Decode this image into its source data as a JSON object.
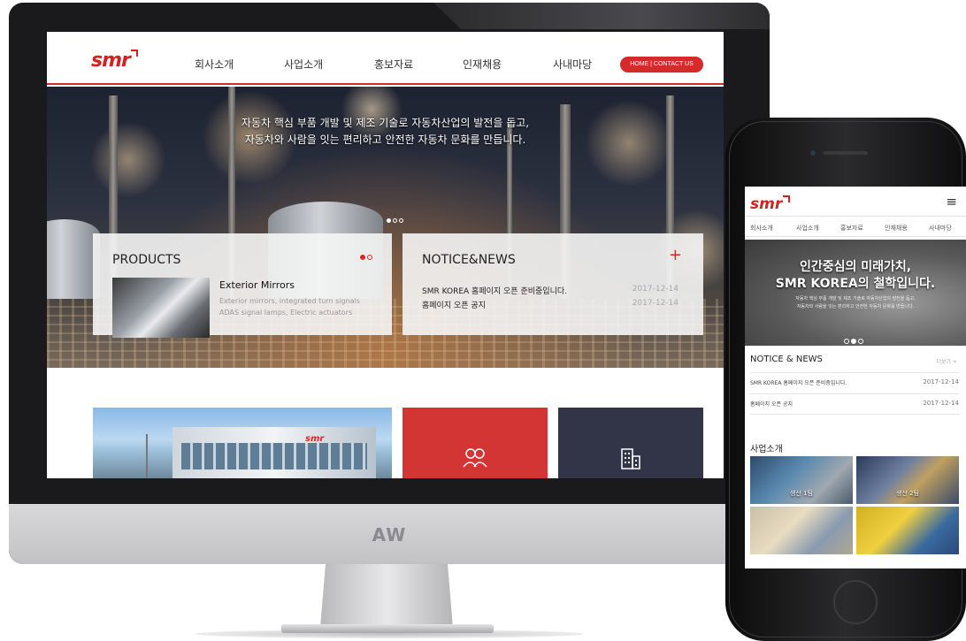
{
  "monitor": {
    "brand": "AW"
  },
  "site": {
    "logo": "smr",
    "nav": [
      "회사소개",
      "사업소개",
      "홍보자료",
      "인재채용",
      "사내마당"
    ],
    "contact_button": "HOME | CONTACT US",
    "hero": {
      "line1": "자동차 핵심 부품 개발 및 제조 기술로 자동차산업의 발전을 돕고,",
      "line2": "자동차와 사람을 잇는 편리하고 안전한 자동차 문화를 만듭니다."
    },
    "products": {
      "title": "PRODUCTS",
      "item_name": "Exterior Mirrors",
      "item_desc_1": "Exterior mirrors, integrated turn signals",
      "item_desc_2": "ADAS signal lamps, Electric actuators"
    },
    "notice": {
      "title": "NOTICE&NEWS",
      "more_icon": "+",
      "items": [
        {
          "title": "SMR KOREA 홈페이지 오픈 준비중입니다.",
          "date": "2017-12-14"
        },
        {
          "title": "홈페이지 오픈 공지",
          "date": "2017-12-14"
        }
      ]
    },
    "tiles": {
      "building_logo": "smr",
      "red_icon": "people-icon",
      "navy_icon": "building-icon"
    }
  },
  "mobile": {
    "logo": "smr",
    "menu_icon": "≡",
    "nav": [
      "회사소개",
      "사업소개",
      "홍보자료",
      "인재채용",
      "사내마당"
    ],
    "hero": {
      "line1": "인간중심의 미래가치,",
      "line2": "SMR KOREA의 철학입니다.",
      "sub1": "자동차 핵심 부품 개발 및 제조 기술로 자동차산업의 발전을 돕고,",
      "sub2": "자동차와 사람을 잇는 편리하고 안전한 자동차 문화를 만듭니다."
    },
    "notice_title": "NOTICE & NEWS",
    "more": "더보기 +",
    "news": [
      {
        "title": "SMR KOREA 홈페이지 오픈 준비중입니다.",
        "date": "2017-12-14"
      },
      {
        "title": "홈페이지 오픈 공지",
        "date": "2017-12-14"
      }
    ],
    "business_title": "사업소개",
    "business": [
      {
        "label": "생산 1팀"
      },
      {
        "label": "생산 2팀"
      },
      {
        "label": ""
      },
      {
        "label": ""
      }
    ]
  },
  "colors": {
    "brand_red": "#d42a2a",
    "tile_navy": "#323547"
  }
}
